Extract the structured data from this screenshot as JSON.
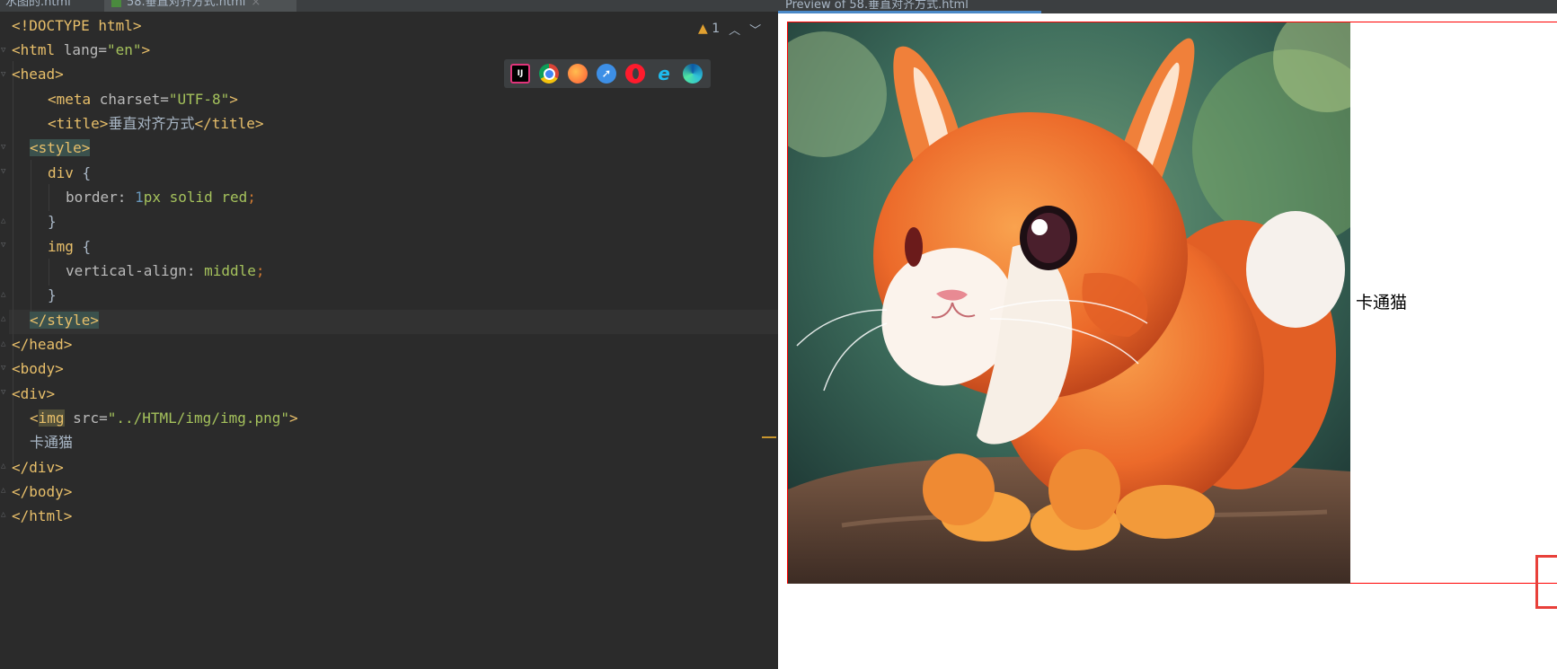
{
  "editor": {
    "tabs": [
      {
        "label": "水图的.html"
      },
      {
        "label": "58.垂直对齐方式.html"
      }
    ],
    "warning_count": "1",
    "browser_icons": [
      "intellij-icon",
      "chrome-icon",
      "firefox-icon",
      "safari-icon",
      "opera-icon",
      "ie-icon",
      "edge-icon"
    ],
    "code": {
      "l1": "<!DOCTYPE html>",
      "l2_tag_open": "<html ",
      "l2_attr": "lang=",
      "l2_val": "\"en\"",
      "l2_close": ">",
      "l3": "<head>",
      "l4_tag": "<meta ",
      "l4_attr": "charset=",
      "l4_val": "\"UTF-8\"",
      "l4_close": ">",
      "l5_open": "<title>",
      "l5_text": "垂直对齐方式",
      "l5_close": "</title>",
      "l6": "<style>",
      "l7_sel": "div",
      "l7_brace": " {",
      "l8_prop": "border: ",
      "l8_num": "1",
      "l8_val": "px solid red",
      "l8_semi": ";",
      "l9": "}",
      "l10_sel": "img",
      "l10_brace": " {",
      "l11_prop": "vertical-align: ",
      "l11_val": "middle",
      "l11_semi": ";",
      "l12": "}",
      "l13": "</style>",
      "l14": "</head>",
      "l15": "<body>",
      "l16": "<div>",
      "l17_lt": "<",
      "l17_tag": "img",
      "l17_attr": " src=",
      "l17_val": "\"../HTML/img/img.png\"",
      "l17_close": ">",
      "l18": "卡通猫",
      "l19": "</div>",
      "l20": "</body>",
      "l21": "</html>"
    }
  },
  "preview": {
    "tab_label": "Preview of 58.垂直对齐方式.html",
    "text": "卡通猫",
    "image_subject": "cartoon orange rabbit"
  },
  "colors": {
    "editor_bg": "#2b2b2b",
    "tag": "#e8bf6a",
    "string": "#a5c25c",
    "number": "#6897bb",
    "border_red": "#ff0000",
    "annotation": "#e8403a"
  }
}
